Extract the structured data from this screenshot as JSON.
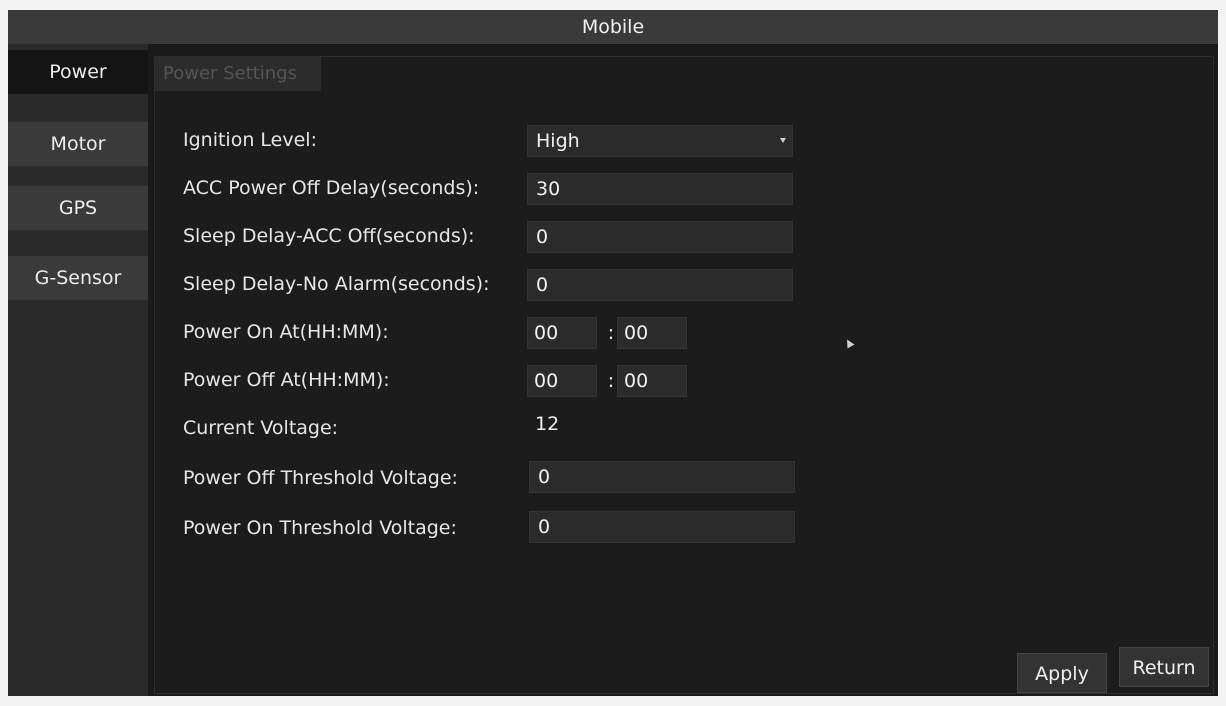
{
  "window": {
    "title": "Mobile"
  },
  "sidebar": {
    "items": [
      {
        "label": "Power",
        "active": true
      },
      {
        "label": "Motor",
        "active": false
      },
      {
        "label": "GPS",
        "active": false
      },
      {
        "label": "G-Sensor",
        "active": false
      }
    ]
  },
  "section": {
    "title": "Power Settings"
  },
  "form": {
    "ignition_level": {
      "label": "Ignition Level:",
      "value": "High"
    },
    "acc_power_off_delay": {
      "label": "ACC Power Off Delay(seconds):",
      "value": "30"
    },
    "sleep_delay_acc_off": {
      "label": "Sleep Delay-ACC Off(seconds):",
      "value": "0"
    },
    "sleep_delay_no_alarm": {
      "label": "Sleep Delay-No Alarm(seconds):",
      "value": "0"
    },
    "power_on_at": {
      "label": "Power On At(HH:MM):",
      "hour": "00",
      "minute": "00",
      "separator": ":"
    },
    "power_off_at": {
      "label": "Power Off At(HH:MM):",
      "hour": "00",
      "minute": "00",
      "separator": ":"
    },
    "current_voltage": {
      "label": "Current Voltage:",
      "value": "12"
    },
    "power_off_threshold": {
      "label": "Power Off Threshold Voltage:",
      "value": "0"
    },
    "power_on_threshold": {
      "label": "Power On Threshold Voltage:",
      "value": "0"
    }
  },
  "buttons": {
    "apply": "Apply",
    "return": "Return"
  },
  "colors": {
    "background": "#1a1a1a",
    "tab_bg": "#3a3a3a",
    "field_bg": "#2b2b2b",
    "text": "#f0f0f0"
  }
}
